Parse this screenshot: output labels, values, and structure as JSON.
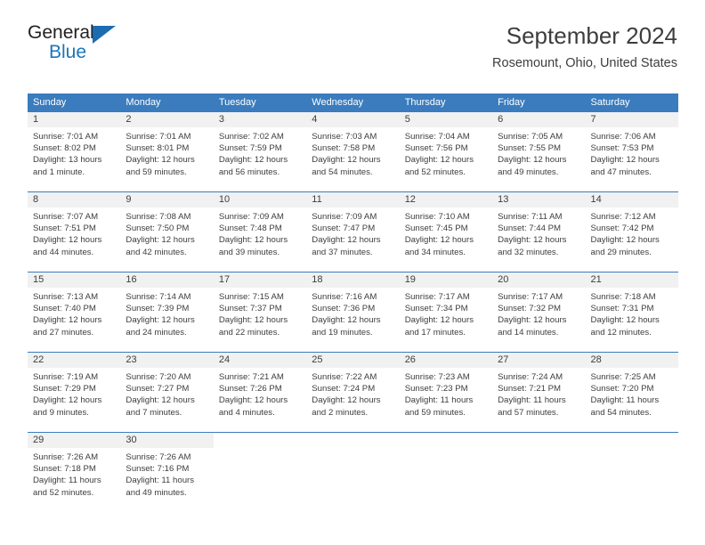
{
  "brand": {
    "name_top": "General",
    "name_bottom": "Blue",
    "triangle_color": "#1b6cb0",
    "blue": "#1b75bb"
  },
  "header": {
    "title": "September 2024",
    "subtitle": "Rosemount, Ohio, United States"
  },
  "theme": {
    "header_blue": "#3a7cbe",
    "day_band_gray": "#f1f1f1",
    "text": "#3d3d3d"
  },
  "weekdays": [
    "Sunday",
    "Monday",
    "Tuesday",
    "Wednesday",
    "Thursday",
    "Friday",
    "Saturday"
  ],
  "weeks": [
    [
      {
        "day": "1",
        "sunrise": "Sunrise: 7:01 AM",
        "sunset": "Sunset: 8:02 PM",
        "daylight1": "Daylight: 13 hours",
        "daylight2": "and 1 minute."
      },
      {
        "day": "2",
        "sunrise": "Sunrise: 7:01 AM",
        "sunset": "Sunset: 8:01 PM",
        "daylight1": "Daylight: 12 hours",
        "daylight2": "and 59 minutes."
      },
      {
        "day": "3",
        "sunrise": "Sunrise: 7:02 AM",
        "sunset": "Sunset: 7:59 PM",
        "daylight1": "Daylight: 12 hours",
        "daylight2": "and 56 minutes."
      },
      {
        "day": "4",
        "sunrise": "Sunrise: 7:03 AM",
        "sunset": "Sunset: 7:58 PM",
        "daylight1": "Daylight: 12 hours",
        "daylight2": "and 54 minutes."
      },
      {
        "day": "5",
        "sunrise": "Sunrise: 7:04 AM",
        "sunset": "Sunset: 7:56 PM",
        "daylight1": "Daylight: 12 hours",
        "daylight2": "and 52 minutes."
      },
      {
        "day": "6",
        "sunrise": "Sunrise: 7:05 AM",
        "sunset": "Sunset: 7:55 PM",
        "daylight1": "Daylight: 12 hours",
        "daylight2": "and 49 minutes."
      },
      {
        "day": "7",
        "sunrise": "Sunrise: 7:06 AM",
        "sunset": "Sunset: 7:53 PM",
        "daylight1": "Daylight: 12 hours",
        "daylight2": "and 47 minutes."
      }
    ],
    [
      {
        "day": "8",
        "sunrise": "Sunrise: 7:07 AM",
        "sunset": "Sunset: 7:51 PM",
        "daylight1": "Daylight: 12 hours",
        "daylight2": "and 44 minutes."
      },
      {
        "day": "9",
        "sunrise": "Sunrise: 7:08 AM",
        "sunset": "Sunset: 7:50 PM",
        "daylight1": "Daylight: 12 hours",
        "daylight2": "and 42 minutes."
      },
      {
        "day": "10",
        "sunrise": "Sunrise: 7:09 AM",
        "sunset": "Sunset: 7:48 PM",
        "daylight1": "Daylight: 12 hours",
        "daylight2": "and 39 minutes."
      },
      {
        "day": "11",
        "sunrise": "Sunrise: 7:09 AM",
        "sunset": "Sunset: 7:47 PM",
        "daylight1": "Daylight: 12 hours",
        "daylight2": "and 37 minutes."
      },
      {
        "day": "12",
        "sunrise": "Sunrise: 7:10 AM",
        "sunset": "Sunset: 7:45 PM",
        "daylight1": "Daylight: 12 hours",
        "daylight2": "and 34 minutes."
      },
      {
        "day": "13",
        "sunrise": "Sunrise: 7:11 AM",
        "sunset": "Sunset: 7:44 PM",
        "daylight1": "Daylight: 12 hours",
        "daylight2": "and 32 minutes."
      },
      {
        "day": "14",
        "sunrise": "Sunrise: 7:12 AM",
        "sunset": "Sunset: 7:42 PM",
        "daylight1": "Daylight: 12 hours",
        "daylight2": "and 29 minutes."
      }
    ],
    [
      {
        "day": "15",
        "sunrise": "Sunrise: 7:13 AM",
        "sunset": "Sunset: 7:40 PM",
        "daylight1": "Daylight: 12 hours",
        "daylight2": "and 27 minutes."
      },
      {
        "day": "16",
        "sunrise": "Sunrise: 7:14 AM",
        "sunset": "Sunset: 7:39 PM",
        "daylight1": "Daylight: 12 hours",
        "daylight2": "and 24 minutes."
      },
      {
        "day": "17",
        "sunrise": "Sunrise: 7:15 AM",
        "sunset": "Sunset: 7:37 PM",
        "daylight1": "Daylight: 12 hours",
        "daylight2": "and 22 minutes."
      },
      {
        "day": "18",
        "sunrise": "Sunrise: 7:16 AM",
        "sunset": "Sunset: 7:36 PM",
        "daylight1": "Daylight: 12 hours",
        "daylight2": "and 19 minutes."
      },
      {
        "day": "19",
        "sunrise": "Sunrise: 7:17 AM",
        "sunset": "Sunset: 7:34 PM",
        "daylight1": "Daylight: 12 hours",
        "daylight2": "and 17 minutes."
      },
      {
        "day": "20",
        "sunrise": "Sunrise: 7:17 AM",
        "sunset": "Sunset: 7:32 PM",
        "daylight1": "Daylight: 12 hours",
        "daylight2": "and 14 minutes."
      },
      {
        "day": "21",
        "sunrise": "Sunrise: 7:18 AM",
        "sunset": "Sunset: 7:31 PM",
        "daylight1": "Daylight: 12 hours",
        "daylight2": "and 12 minutes."
      }
    ],
    [
      {
        "day": "22",
        "sunrise": "Sunrise: 7:19 AM",
        "sunset": "Sunset: 7:29 PM",
        "daylight1": "Daylight: 12 hours",
        "daylight2": "and 9 minutes."
      },
      {
        "day": "23",
        "sunrise": "Sunrise: 7:20 AM",
        "sunset": "Sunset: 7:27 PM",
        "daylight1": "Daylight: 12 hours",
        "daylight2": "and 7 minutes."
      },
      {
        "day": "24",
        "sunrise": "Sunrise: 7:21 AM",
        "sunset": "Sunset: 7:26 PM",
        "daylight1": "Daylight: 12 hours",
        "daylight2": "and 4 minutes."
      },
      {
        "day": "25",
        "sunrise": "Sunrise: 7:22 AM",
        "sunset": "Sunset: 7:24 PM",
        "daylight1": "Daylight: 12 hours",
        "daylight2": "and 2 minutes."
      },
      {
        "day": "26",
        "sunrise": "Sunrise: 7:23 AM",
        "sunset": "Sunset: 7:23 PM",
        "daylight1": "Daylight: 11 hours",
        "daylight2": "and 59 minutes."
      },
      {
        "day": "27",
        "sunrise": "Sunrise: 7:24 AM",
        "sunset": "Sunset: 7:21 PM",
        "daylight1": "Daylight: 11 hours",
        "daylight2": "and 57 minutes."
      },
      {
        "day": "28",
        "sunrise": "Sunrise: 7:25 AM",
        "sunset": "Sunset: 7:20 PM",
        "daylight1": "Daylight: 11 hours",
        "daylight2": "and 54 minutes."
      }
    ],
    [
      {
        "day": "29",
        "sunrise": "Sunrise: 7:26 AM",
        "sunset": "Sunset: 7:18 PM",
        "daylight1": "Daylight: 11 hours",
        "daylight2": "and 52 minutes."
      },
      {
        "day": "30",
        "sunrise": "Sunrise: 7:26 AM",
        "sunset": "Sunset: 7:16 PM",
        "daylight1": "Daylight: 11 hours",
        "daylight2": "and 49 minutes."
      },
      {
        "day": "",
        "sunrise": "",
        "sunset": "",
        "daylight1": "",
        "daylight2": ""
      },
      {
        "day": "",
        "sunrise": "",
        "sunset": "",
        "daylight1": "",
        "daylight2": ""
      },
      {
        "day": "",
        "sunrise": "",
        "sunset": "",
        "daylight1": "",
        "daylight2": ""
      },
      {
        "day": "",
        "sunrise": "",
        "sunset": "",
        "daylight1": "",
        "daylight2": ""
      },
      {
        "day": "",
        "sunrise": "",
        "sunset": "",
        "daylight1": "",
        "daylight2": ""
      }
    ]
  ]
}
